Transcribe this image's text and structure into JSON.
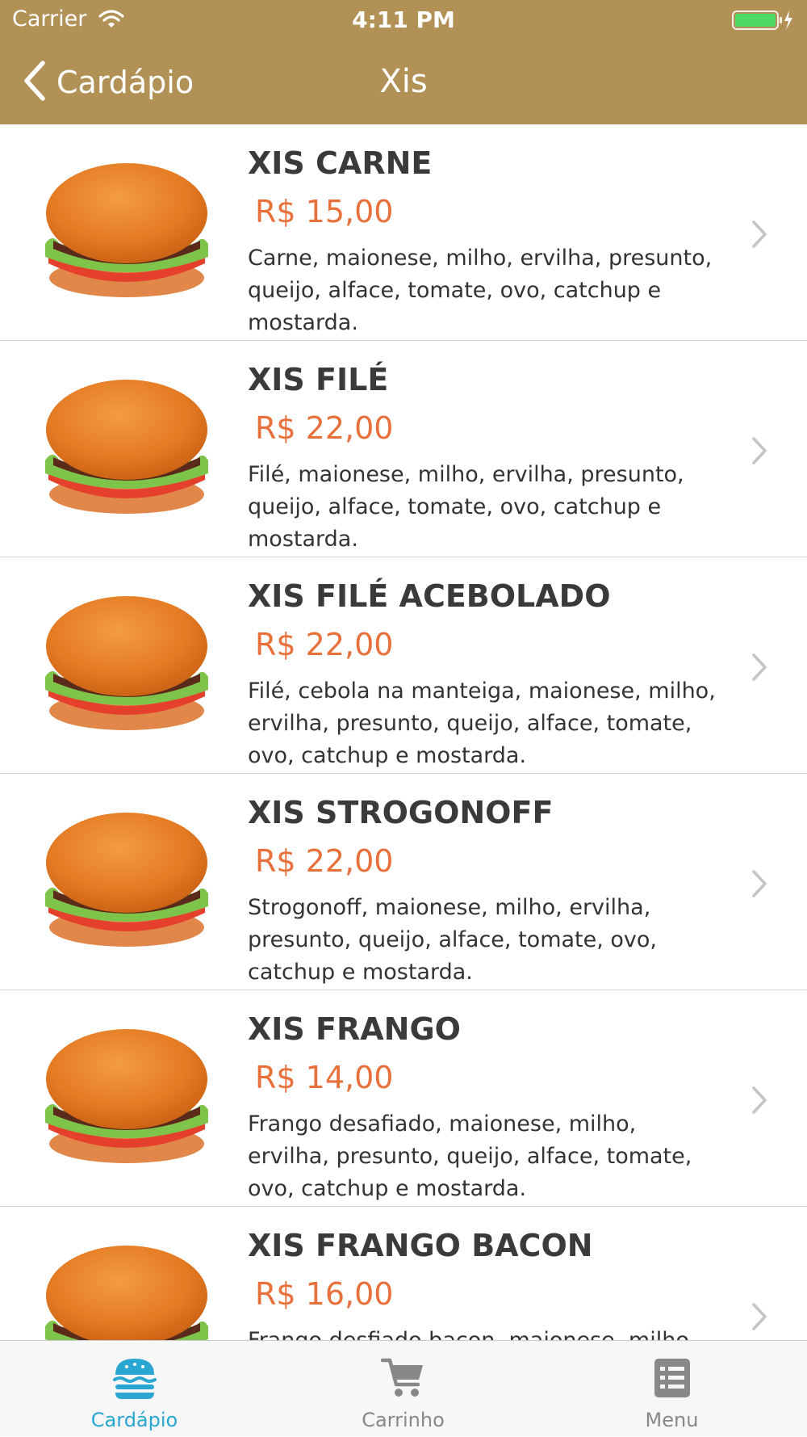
{
  "status_bar": {
    "carrier": "Carrier",
    "time": "4:11 PM"
  },
  "nav": {
    "back_label": "Cardápio",
    "title": "Xis"
  },
  "items": [
    {
      "name": "XIS CARNE",
      "price": "R$ 15,00",
      "description": "Carne, maionese, milho, ervilha, presunto, queijo, alface, tomate, ovo, catchup e mostarda."
    },
    {
      "name": "XIS FILÉ",
      "price": "R$ 22,00",
      "description": "Filé, maionese, milho, ervilha, presunto, queijo, alface, tomate, ovo, catchup e mostarda."
    },
    {
      "name": "XIS FILÉ ACEBOLADO",
      "price": "R$ 22,00",
      "description": "Filé, cebola na manteiga, maionese, milho, ervilha, presunto, queijo, alface, tomate, ovo, catchup e mostarda."
    },
    {
      "name": "XIS STROGONOFF",
      "price": "R$ 22,00",
      "description": "Strogonoff, maionese, milho, ervilha, presunto, queijo, alface, tomate, ovo, catchup e mostarda."
    },
    {
      "name": "XIS FRANGO",
      "price": "R$ 14,00",
      "description": "Frango desafiado, maionese, milho, ervilha, presunto, queijo, alface, tomate, ovo, catchup e mostarda."
    },
    {
      "name": "XIS FRANGO BACON",
      "price": "R$ 16,00",
      "description": "Frango desfiado bacon, maionese, milho,"
    }
  ],
  "tabs": [
    {
      "label": "Cardápio",
      "icon": "burger-icon",
      "active": true
    },
    {
      "label": "Carrinho",
      "icon": "cart-icon",
      "active": false
    },
    {
      "label": "Menu",
      "icon": "list-icon",
      "active": false
    }
  ],
  "colors": {
    "nav_bg": "#b29157",
    "price": "#e8703a",
    "tab_active": "#2aa6d2",
    "tab_inactive": "#888888"
  }
}
